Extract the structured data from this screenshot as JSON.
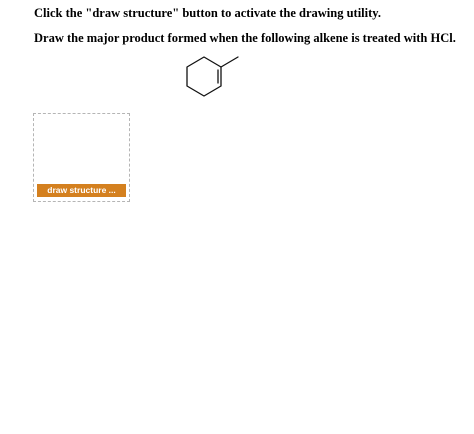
{
  "instruction_text": "Click the \"draw structure\" button to activate the drawing utility.",
  "question_text": "Draw the major product formed when the following alkene is treated with HCl.",
  "molecule_icon": "1-methylcyclohexene-structure",
  "draw_structure_label": "draw structure ...",
  "colors": {
    "button_bg": "#d4801f",
    "button_text": "#ffffff",
    "box_border": "#b5b5b5"
  }
}
